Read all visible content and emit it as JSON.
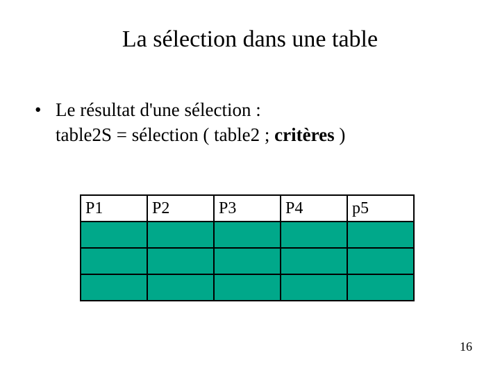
{
  "title": "La sélection dans une table",
  "bullet1_prefix": "• ",
  "bullet1": "Le résultat d'une sélection :",
  "line2_a": "table2S = sélection ( table2 ; ",
  "line2_b": "critères",
  "line2_c": " )",
  "table": {
    "headers": [
      "P1",
      "P2",
      "P3",
      "P4",
      "p5"
    ]
  },
  "page_number": "16"
}
